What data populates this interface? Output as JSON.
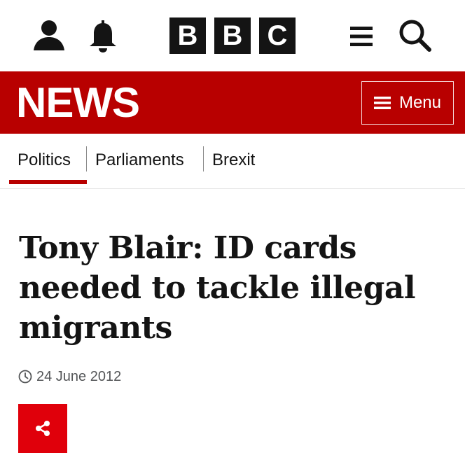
{
  "masthead": {
    "logo_letters": [
      "B",
      "B",
      "C"
    ],
    "icons": {
      "account": "user-icon",
      "notifications": "bell-icon",
      "menu": "hamburger-menu-icon",
      "search": "search-icon"
    }
  },
  "news_bar": {
    "wordmark": "NEWS",
    "menu_label": "Menu",
    "background_color": "#b80000"
  },
  "section_nav": {
    "items": [
      {
        "label": "Politics",
        "active": true
      },
      {
        "label": "Parliaments",
        "active": false
      },
      {
        "label": "Brexit",
        "active": false
      }
    ],
    "active_color": "#b80000"
  },
  "article": {
    "headline": "Tony Blair: ID cards needed to tackle illegal migrants",
    "date": "24 June 2012",
    "share_icon": "share-icon",
    "share_color": "#e0000b"
  }
}
